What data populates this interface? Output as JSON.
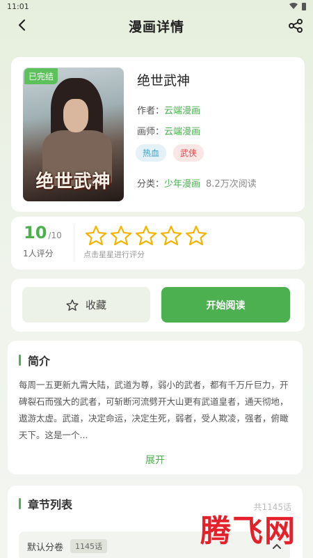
{
  "status_bar": {
    "time": "11:01"
  },
  "header": {
    "title": "漫画详情"
  },
  "comic": {
    "badge": "已完结",
    "cover_title": "绝世武神",
    "name": "绝世武神",
    "author_label": "作者：",
    "author": "云端漫画",
    "artist_label": "画师：",
    "artist": "云端漫画",
    "tags": [
      "热血",
      "武侠"
    ],
    "category_label": "分类：",
    "category": "少年漫画",
    "reads": "8.2万次阅读"
  },
  "rating": {
    "score": "10",
    "max": "/10",
    "count": "1人评分",
    "stars": 5,
    "hint": "点击星星进行评分"
  },
  "actions": {
    "favorite_label": "收藏",
    "read_label": "开始阅读"
  },
  "intro": {
    "title": "简介",
    "text": "每周一五更新九霄大陆，武道为尊，弱小的武者，都有千万斤巨力，开碑裂石而强大的武者，可斩断河流劈开大山更有武道皇者，通天彻地，遨游太虚。武道，决定命运，决定生死，弱者，受人欺凌，强者，俯瞰天下。这是一个...",
    "expand_label": "展开"
  },
  "chapters": {
    "title": "章节列表",
    "total": "共1145话",
    "volume_name": "默认分卷",
    "volume_count": "1145话"
  },
  "watermark": "腾飞网",
  "colors": {
    "accent": "#4caf50",
    "tag_blue": "#3ba1c9",
    "tag_red": "#e04a4a",
    "watermark": "#e4212a"
  }
}
